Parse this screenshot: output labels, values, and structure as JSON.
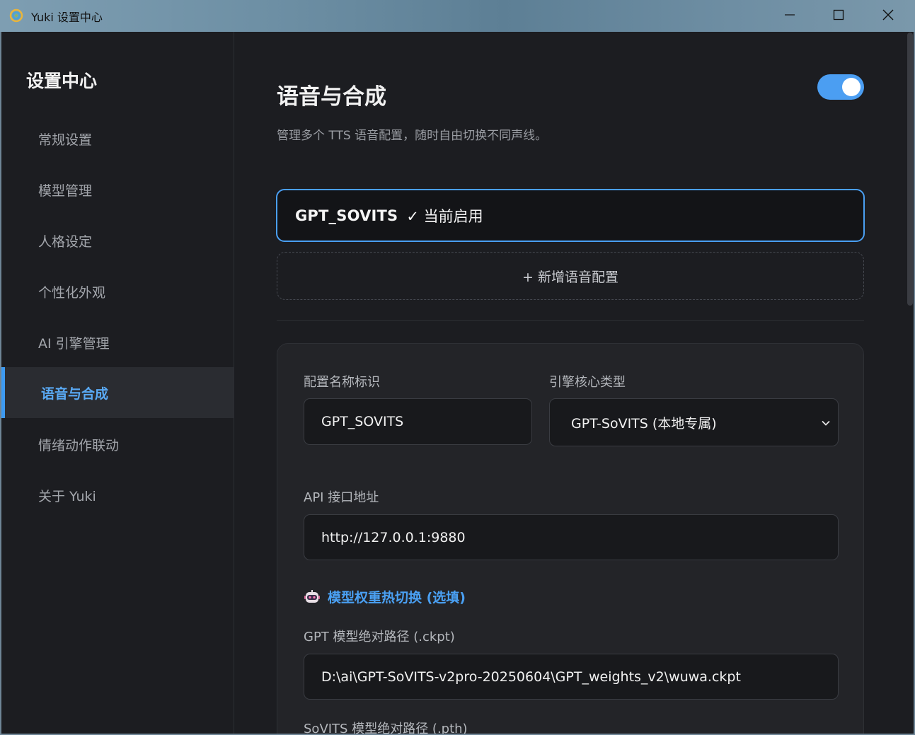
{
  "window": {
    "title": "Yuki 设置中心",
    "controls": {
      "minimize": "minimize-icon",
      "maximize": "maximize-icon",
      "close": "close-icon"
    }
  },
  "sidebar": {
    "title": "设置中心",
    "items": [
      {
        "label": "常规设置",
        "active": false
      },
      {
        "label": "模型管理",
        "active": false
      },
      {
        "label": "人格设定",
        "active": false
      },
      {
        "label": "个性化外观",
        "active": false
      },
      {
        "label": "AI 引擎管理",
        "active": false
      },
      {
        "label": "语音与合成",
        "active": true
      },
      {
        "label": "情绪动作联动",
        "active": false
      },
      {
        "label": "关于 Yuki",
        "active": false
      }
    ]
  },
  "main": {
    "title": "语音与合成",
    "description": "管理多个 TTS 语音配置，随时自由切换不同声线。",
    "enabled": true,
    "profile": {
      "name": "GPT_SOVITS",
      "status": "✓ 当前启用"
    },
    "add_profile_label": "+ 新增语音配置",
    "form": {
      "config_name_label": "配置名称标识",
      "config_name_value": "GPT_SOVITS",
      "engine_type_label": "引擎核心类型",
      "engine_type_value": "GPT-SoVITS (本地专属)",
      "api_label": "API 接口地址",
      "api_value": "http://127.0.0.1:9880",
      "section_title": "模型权重热切换 (选填)",
      "gpt_path_label": "GPT 模型绝对路径 (.ckpt)",
      "gpt_path_value": "D:\\ai\\GPT-SoVITS-v2pro-20250604\\GPT_weights_v2\\wuwa.ckpt",
      "sovits_path_label": "SoVITS 模型绝对路径 (.pth)"
    }
  },
  "colors": {
    "accent": "#4a9ff2",
    "active_nav_text": "#5aaaf5",
    "background": "#1c1d21"
  }
}
